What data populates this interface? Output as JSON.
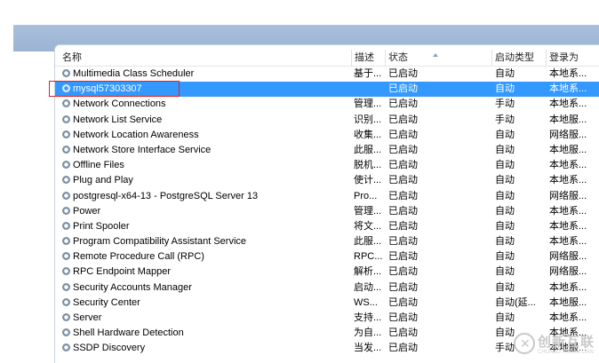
{
  "columns": {
    "name": "名称",
    "description": "描述",
    "status": "状态",
    "startup": "启动类型",
    "logon": "登录为"
  },
  "services": [
    {
      "name": "Multimedia Class Scheduler",
      "description": "基于...",
      "status": "已启动",
      "startup": "自动",
      "logon": "本地系..."
    },
    {
      "name": "mysql57303307",
      "description": "",
      "status": "已启动",
      "startup": "自动",
      "logon": "本地系...",
      "selected": true
    },
    {
      "name": "Network Connections",
      "description": "管理...",
      "status": "已启动",
      "startup": "手动",
      "logon": "本地系..."
    },
    {
      "name": "Network List Service",
      "description": "识别...",
      "status": "已启动",
      "startup": "手动",
      "logon": "本地服..."
    },
    {
      "name": "Network Location Awareness",
      "description": "收集...",
      "status": "已启动",
      "startup": "自动",
      "logon": "网络服..."
    },
    {
      "name": "Network Store Interface Service",
      "description": "此服...",
      "status": "已启动",
      "startup": "自动",
      "logon": "本地服..."
    },
    {
      "name": "Offline Files",
      "description": "脱机...",
      "status": "已启动",
      "startup": "自动",
      "logon": "本地系..."
    },
    {
      "name": "Plug and Play",
      "description": "使计...",
      "status": "已启动",
      "startup": "自动",
      "logon": "本地系..."
    },
    {
      "name": "postgresql-x64-13 - PostgreSQL Server 13",
      "description": "Pro...",
      "status": "已启动",
      "startup": "自动",
      "logon": "网络服..."
    },
    {
      "name": "Power",
      "description": "管理...",
      "status": "已启动",
      "startup": "自动",
      "logon": "本地系..."
    },
    {
      "name": "Print Spooler",
      "description": "将文...",
      "status": "已启动",
      "startup": "自动",
      "logon": "本地系..."
    },
    {
      "name": "Program Compatibility Assistant Service",
      "description": "此服...",
      "status": "已启动",
      "startup": "自动",
      "logon": "本地系..."
    },
    {
      "name": "Remote Procedure Call (RPC)",
      "description": "RPC...",
      "status": "已启动",
      "startup": "自动",
      "logon": "网络服..."
    },
    {
      "name": "RPC Endpoint Mapper",
      "description": "解析...",
      "status": "已启动",
      "startup": "自动",
      "logon": "网络服..."
    },
    {
      "name": "Security Accounts Manager",
      "description": "启动...",
      "status": "已启动",
      "startup": "自动",
      "logon": "本地系..."
    },
    {
      "name": "Security Center",
      "description": "WS...",
      "status": "已启动",
      "startup": "自动(延...",
      "logon": "本地服..."
    },
    {
      "name": "Server",
      "description": "支持...",
      "status": "已启动",
      "startup": "自动",
      "logon": "本地系..."
    },
    {
      "name": "Shell Hardware Detection",
      "description": "为自...",
      "status": "已启动",
      "startup": "自动",
      "logon": "本地系..."
    },
    {
      "name": "SSDP Discovery",
      "description": "当发...",
      "status": "已启动",
      "startup": "手动",
      "logon": "本地服..."
    }
  ],
  "watermark": {
    "text": "创新互联",
    "sub": "CHUANG XIN HU LIAN"
  }
}
